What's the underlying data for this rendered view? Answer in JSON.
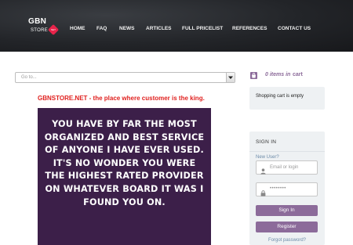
{
  "header": {
    "logo_main": "GBN",
    "logo_sub": "STORE",
    "logo_badge": "NET",
    "nav": [
      {
        "label": "HOME"
      },
      {
        "label": "FAQ"
      },
      {
        "label": "NEWS"
      },
      {
        "label": "ARTICLES"
      },
      {
        "label": "FULL PRICELIST"
      },
      {
        "label": "REFERENCES"
      },
      {
        "label": "CONTACT US"
      }
    ]
  },
  "goto": {
    "label": "Go to..."
  },
  "tagline": {
    "site": "GBNSTORE.NET",
    "rest": " - the place where customer is the king."
  },
  "testimonial": {
    "text": "YOU HAVE BY FAR THE MOST ORGANIZED AND BEST SERVICE OF ANYONE I HAVE EVER USED. IT'S NO WONDER YOU WERE THE HIGHEST RATED PROVIDER ON WHATEVER BOARD IT WAS I FOUND YOU ON."
  },
  "cart": {
    "count_text": "0 items in",
    "word": "cart",
    "empty_text": "Shopping cart is empty",
    "icon": "shopping-bag-icon"
  },
  "signin": {
    "title": "SIGN IN",
    "new_user": "New User?",
    "email_placeholder": "Email or login",
    "password_masked": "••••••••",
    "signin_label": "Sign In",
    "register_label": "Register",
    "forgot_label": "Forgot password?"
  },
  "colors": {
    "accent": "#8c6b9a",
    "testimonial_bg": "#3c1f49",
    "tagline": "#e0201e",
    "badge": "#e8234a"
  }
}
